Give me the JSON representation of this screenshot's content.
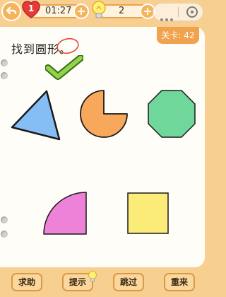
{
  "topbar": {
    "lives": "1",
    "timer": "01:27",
    "hints": "2",
    "plus_symbol": "+",
    "icons": [
      "back-arrow-icon",
      "heart-icon",
      "plus-icon",
      "lightbulb-icon",
      "plus-icon",
      "more-dots-icon",
      "close-target-icon"
    ]
  },
  "level": {
    "label": "关卡: 42"
  },
  "question": {
    "text": "找到圆形。"
  },
  "shapes": [
    "triangle",
    "pacman-circle",
    "octagon",
    "quarter-circle",
    "square"
  ],
  "colors": {
    "triangle": "#85bdf5",
    "circle": "#f7a85a",
    "octagon": "#6fd79a",
    "quarter": "#ee82d8",
    "square": "#fbec7a",
    "check": "#8fd44a",
    "accent": "#f0a24c"
  },
  "bottom": {
    "help": "求助",
    "hint": "提示",
    "skip": "跳过",
    "restart": "重来"
  }
}
